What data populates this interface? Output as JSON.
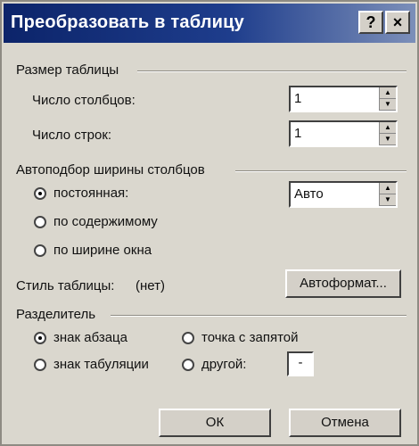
{
  "dialog": {
    "title": "Преобразовать в таблицу",
    "help_label": "?",
    "close_label": "×"
  },
  "table_size": {
    "group_label": "Размер таблицы",
    "columns_label": "Число столбцов:",
    "columns_value": "1",
    "rows_label": "Число строк:",
    "rows_value": "1"
  },
  "autofit": {
    "group_label": "Автоподбор ширины столбцов",
    "fixed_label": "постоянная:",
    "fixed_value": "Авто",
    "content_label": "по содержимому",
    "window_label": "по ширине окна",
    "selected": "fixed"
  },
  "table_style": {
    "label": "Стиль таблицы:",
    "value": "(нет)",
    "autoformat_label": "Автоформат..."
  },
  "separator": {
    "group_label": "Разделитель",
    "paragraph_label": "знак абзаца",
    "semicolon_label": "точка с запятой",
    "tab_label": "знак табуляции",
    "other_label": "другой:",
    "other_value": "-",
    "selected": "paragraph"
  },
  "buttons": {
    "ok_label": "ОК",
    "cancel_label": "Отмена"
  },
  "colors": {
    "titlebar_start": "#0c246a",
    "titlebar_end": "#7c8fb9",
    "dialog_bg": "#dad7ce"
  }
}
